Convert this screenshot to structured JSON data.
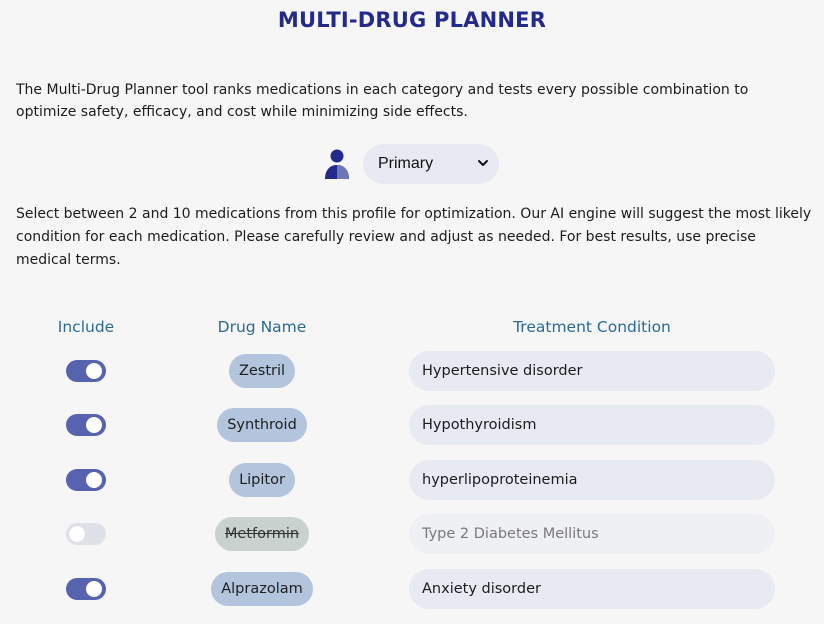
{
  "title": "MULTI-DRUG PLANNER",
  "intro": "The Multi-Drug Planner tool ranks medications in each category and tests every possible combination to optimize safety, efficacy, and cost while minimizing side effects.",
  "profile": {
    "icon": "person-icon",
    "selected": "Primary"
  },
  "instructions": "Select between 2 and 10 medications from this profile for optimization. Our AI engine will suggest the most likely condition for each medication. Please carefully review and adjust as needed. For best results, use precise medical terms.",
  "table": {
    "headers": {
      "include": "Include",
      "drug_name": "Drug Name",
      "condition": "Treatment Condition"
    },
    "rows": [
      {
        "include": true,
        "drug": "Zestril",
        "condition": "Hypertensive disorder"
      },
      {
        "include": true,
        "drug": "Synthroid",
        "condition": "Hypothyroidism"
      },
      {
        "include": true,
        "drug": "Lipitor",
        "condition": "hyperlipoproteinemia"
      },
      {
        "include": false,
        "drug": "Metformin",
        "condition": "Type 2 Diabetes Mellitus"
      },
      {
        "include": true,
        "drug": "Alprazolam",
        "condition": "Anxiety disorder"
      }
    ]
  },
  "colors": {
    "title": "#232a8a",
    "header": "#2a6a93",
    "toggle_on": "#5763ae",
    "toggle_off": "#dfe1e8",
    "drug_pill": "#b3c4dd",
    "drug_pill_disabled": "#c9d2cf",
    "input_bg": "#e7eaf3"
  }
}
